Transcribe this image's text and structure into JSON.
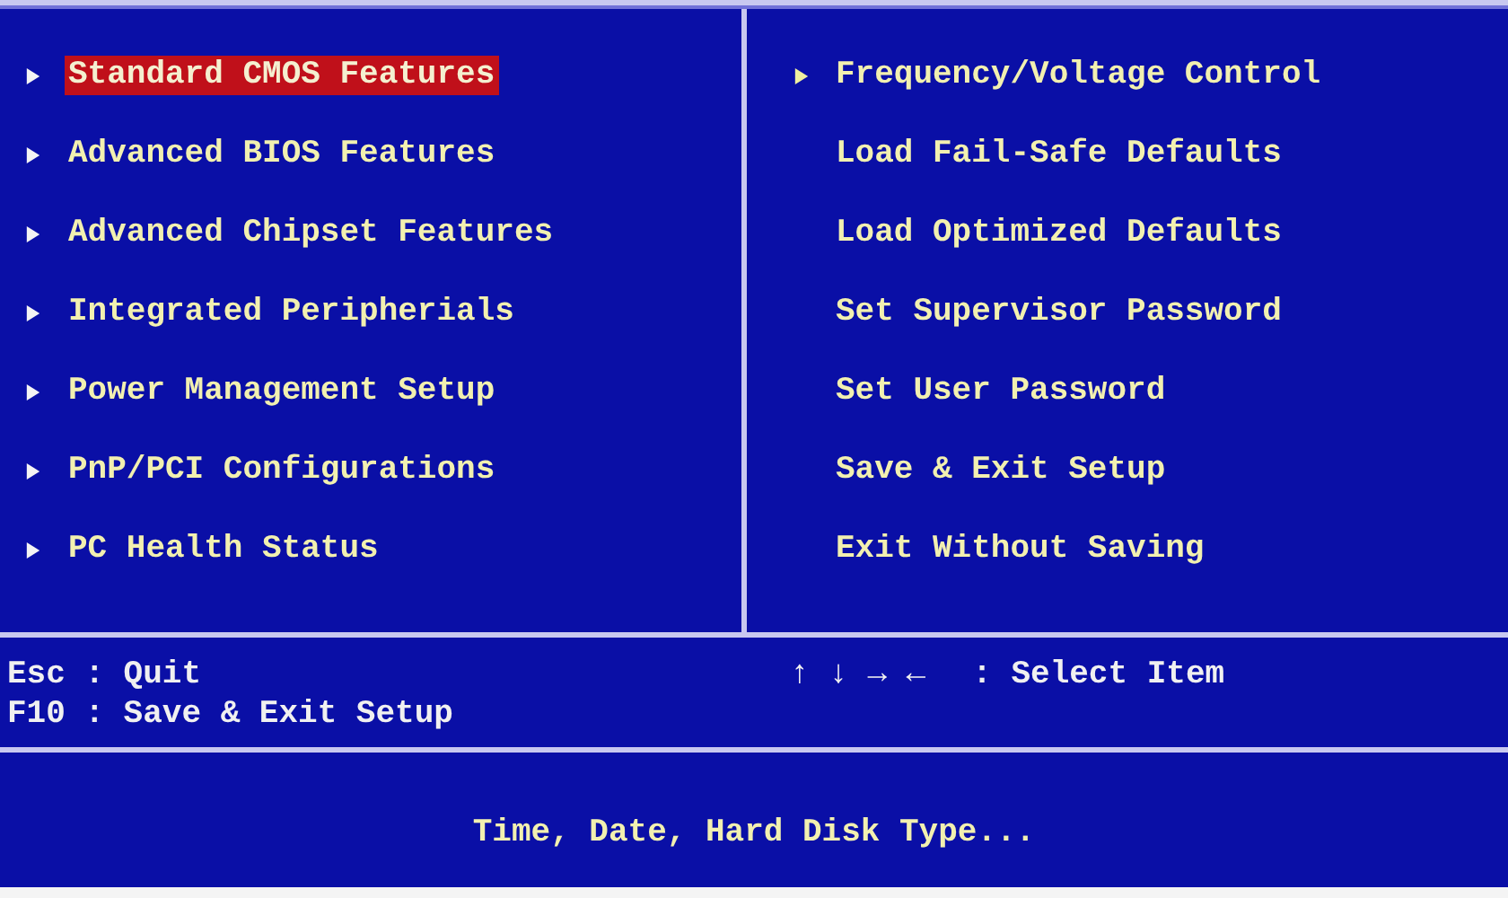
{
  "left_menu": [
    {
      "label": "Standard CMOS Features",
      "submenu": true,
      "selected": true
    },
    {
      "label": "Advanced BIOS Features",
      "submenu": true,
      "selected": false
    },
    {
      "label": "Advanced Chipset Features",
      "submenu": true,
      "selected": false
    },
    {
      "label": "Integrated Peripherials",
      "submenu": true,
      "selected": false
    },
    {
      "label": "Power Management Setup",
      "submenu": true,
      "selected": false
    },
    {
      "label": "PnP/PCI Configurations",
      "submenu": true,
      "selected": false
    },
    {
      "label": "PC Health Status",
      "submenu": true,
      "selected": false
    }
  ],
  "right_menu": [
    {
      "label": "Frequency/Voltage Control",
      "submenu": true,
      "selected": false
    },
    {
      "label": "Load Fail-Safe Defaults",
      "submenu": false,
      "selected": false
    },
    {
      "label": "Load Optimized Defaults",
      "submenu": false,
      "selected": false
    },
    {
      "label": "Set Supervisor Password",
      "submenu": false,
      "selected": false
    },
    {
      "label": "Set User Password",
      "submenu": false,
      "selected": false
    },
    {
      "label": "Save & Exit Setup",
      "submenu": false,
      "selected": false
    },
    {
      "label": "Exit Without Saving",
      "submenu": false,
      "selected": false
    }
  ],
  "key_help_left": [
    "Esc : Quit",
    "F10 : Save & Exit Setup"
  ],
  "key_help_right": {
    "keys": "↑ ↓ → ←",
    "action": ": Select Item"
  },
  "status_text": "Time, Date, Hard Disk Type..."
}
